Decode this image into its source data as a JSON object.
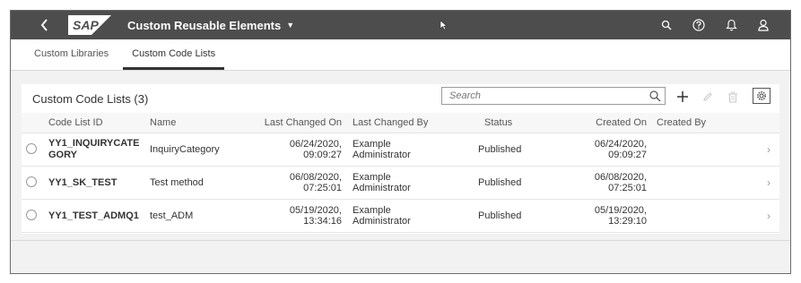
{
  "shell": {
    "back_icon": "chevron-left-icon",
    "logo_text": "SAP",
    "app_title": "Custom Reusable Elements",
    "icons": [
      "search-icon",
      "help-icon",
      "notification-bell-icon",
      "user-profile-icon"
    ]
  },
  "tabs": [
    {
      "label": "Custom Libraries",
      "active": false
    },
    {
      "label": "Custom Code Lists",
      "active": true
    }
  ],
  "table": {
    "title": "Custom Code Lists (3)",
    "search_placeholder": "Search",
    "columns": [
      "Code List ID",
      "Name",
      "Last Changed On",
      "Last Changed By",
      "Status",
      "Created On",
      "Created By"
    ],
    "rows": [
      {
        "id_line1": "YY1_INQUIRYCATE",
        "id_line2": "GORY",
        "name": "InquiryCategory",
        "changed_date": "06/24/2020,",
        "changed_time": "09:09:27",
        "changed_by1": "Example",
        "changed_by2": "Administrator",
        "status": "Published",
        "created_date": "06/24/2020,",
        "created_time": "09:09:27",
        "created_by": ""
      },
      {
        "id_line1": "YY1_SK_TEST",
        "id_line2": "",
        "name": "Test method",
        "changed_date": "06/08/2020,",
        "changed_time": "07:25:01",
        "changed_by1": "Example",
        "changed_by2": "Administrator",
        "status": "Published",
        "created_date": "06/08/2020,",
        "created_time": "07:25:01",
        "created_by": ""
      },
      {
        "id_line1": "YY1_TEST_ADMQ1",
        "id_line2": "",
        "name": "test_ADM",
        "changed_date": "05/19/2020,",
        "changed_time": "13:34:16",
        "changed_by1": "Example",
        "changed_by2": "Administrator",
        "status": "Published",
        "created_date": "05/19/2020,",
        "created_time": "13:29:10",
        "created_by": ""
      }
    ]
  },
  "colors": {
    "shell_bg": "#4d4d4d",
    "page_bg": "#f2f2f2",
    "panel_bg": "#ffffff"
  }
}
